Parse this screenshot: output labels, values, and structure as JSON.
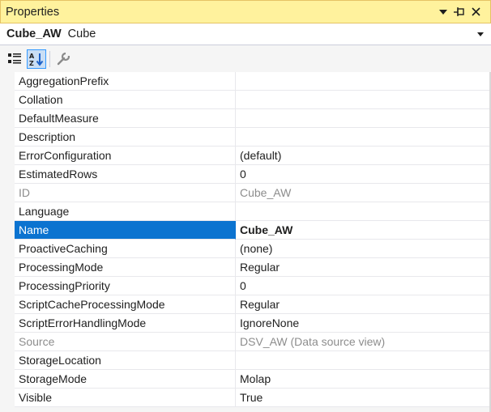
{
  "window": {
    "title": "Properties"
  },
  "object_selector": {
    "name": "Cube_AW",
    "type": "Cube"
  },
  "toolbar": {
    "buttons": [
      {
        "icon": "categorized-icon",
        "active": false
      },
      {
        "icon": "alphabetical-icon",
        "active": true
      },
      {
        "icon": "property-pages-icon",
        "active": false
      }
    ]
  },
  "properties": [
    {
      "name": "AggregationPrefix",
      "value": ""
    },
    {
      "name": "Collation",
      "value": ""
    },
    {
      "name": "DefaultMeasure",
      "value": ""
    },
    {
      "name": "Description",
      "value": ""
    },
    {
      "name": "ErrorConfiguration",
      "value": "(default)"
    },
    {
      "name": "EstimatedRows",
      "value": "0"
    },
    {
      "name": "ID",
      "value": "Cube_AW",
      "readonly": true
    },
    {
      "name": "Language",
      "value": ""
    },
    {
      "name": "Name",
      "value": "Cube_AW",
      "selected": true
    },
    {
      "name": "ProactiveCaching",
      "value": "(none)"
    },
    {
      "name": "ProcessingMode",
      "value": "Regular"
    },
    {
      "name": "ProcessingPriority",
      "value": "0"
    },
    {
      "name": "ScriptCacheProcessingMode",
      "value": "Regular"
    },
    {
      "name": "ScriptErrorHandlingMode",
      "value": "IgnoreNone"
    },
    {
      "name": "Source",
      "value": "DSV_AW (Data source view)",
      "readonly": true
    },
    {
      "name": "StorageLocation",
      "value": ""
    },
    {
      "name": "StorageMode",
      "value": "Molap"
    },
    {
      "name": "Visible",
      "value": "True"
    }
  ],
  "colors": {
    "titlebar": "#fff29d",
    "selection": "#0b73d0",
    "readonly_text": "#8d8d8d"
  }
}
